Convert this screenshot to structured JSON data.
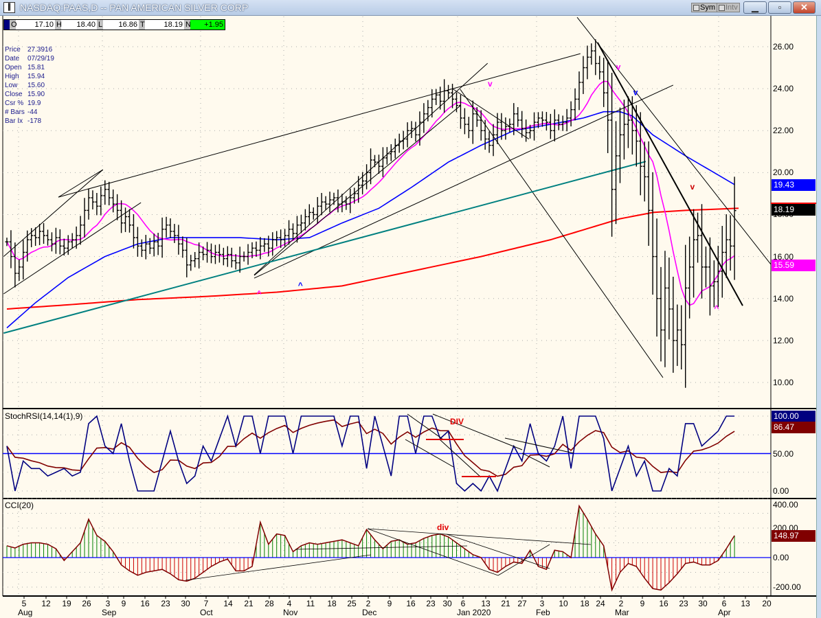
{
  "window": {
    "title": "NASDAQ:PAAS,D -- PAN AMERICAN SILVER CORP",
    "icon": "chart-app-icon",
    "sym_btn": "Sym",
    "intv_btn": "Intv",
    "minimize": "minimize-icon",
    "maximize": "maximize-icon",
    "close": "close-icon"
  },
  "ohlc_bar": {
    "o_label": "O",
    "o": "17.10",
    "h_label": "H",
    "h": "18.40",
    "l_label": "L",
    "l": "16.86",
    "t_label": "T",
    "t": "18.19",
    "n_label": "N",
    "n": "+1.95",
    "n_color": "#00ff00"
  },
  "info": [
    {
      "label": "Price",
      "value": "27.3916"
    },
    {
      "label": "Date",
      "value": "07/29/19"
    },
    {
      "label": "Open",
      "value": "15.81"
    },
    {
      "label": "High",
      "value": "15.94"
    },
    {
      "label": "Low",
      "value": "15.60"
    },
    {
      "label": "Close",
      "value": "15.90"
    },
    {
      "label": "Csr %",
      "value": "19.9"
    },
    {
      "label": "# Bars",
      "value": "-44"
    },
    {
      "label": "Bar Ix",
      "value": "-178"
    }
  ],
  "colors": {
    "ma_fast": "#ff00ff",
    "ma_mid": "#0000ff",
    "ma_slow": "#ff0000",
    "teal": "#008080",
    "up": "#008000",
    "down": "#cc0000",
    "cci_line": "#800000",
    "stoch_k": "#000080",
    "stoch_d": "#800000"
  },
  "chart_data": [
    {
      "type": "ohlc",
      "title": "NASDAQ:PAAS,D",
      "ylim": [
        9,
        27.5
      ],
      "yticks": [
        "26.00",
        "24.00",
        "22.00",
        "20.00",
        "18.00",
        "16.00",
        "14.00",
        "12.00",
        "10.00"
      ],
      "closes": [
        16.7,
        16.0,
        15.2,
        15.5,
        16.2,
        16.8,
        17.0,
        16.9,
        17.2,
        17.0,
        16.8,
        16.6,
        16.9,
        16.5,
        16.4,
        16.7,
        16.8,
        17.0,
        17.5,
        18.2,
        18.8,
        18.6,
        18.4,
        18.9,
        19.2,
        18.8,
        18.5,
        18.2,
        17.6,
        17.9,
        17.5,
        16.9,
        16.5,
        16.3,
        16.6,
        16.4,
        16.7,
        16.5,
        17.3,
        17.5,
        17.2,
        17.0,
        16.6,
        16.3,
        15.6,
        15.8,
        15.9,
        16.2,
        16.1,
        16.3,
        16.0,
        16.2,
        16.1,
        15.9,
        16.1,
        15.8,
        15.7,
        16.0,
        16.0,
        16.2,
        16.4,
        16.3,
        16.5,
        16.6,
        16.4,
        16.8,
        16.9,
        16.8,
        17.0,
        17.3,
        17.1,
        17.5,
        17.6,
        17.9,
        18.1,
        18.0,
        18.4,
        18.6,
        18.5,
        18.7,
        18.8,
        18.5,
        18.6,
        18.5,
        18.8,
        19.0,
        19.4,
        19.6,
        20.0,
        20.6,
        20.5,
        20.3,
        20.7,
        20.9,
        21.0,
        21.3,
        21.5,
        21.6,
        22.0,
        22.1,
        21.8,
        22.4,
        22.8,
        23.1,
        23.5,
        23.7,
        23.4,
        23.9,
        23.8,
        23.5,
        23.2,
        22.6,
        22.3,
        22.0,
        22.8,
        22.5,
        22.0,
        21.6,
        21.3,
        21.8,
        22.4,
        22.0,
        22.2,
        22.3,
        22.8,
        22.5,
        22.1,
        21.9,
        22.0,
        22.4,
        22.6,
        22.5,
        22.4,
        22.0,
        22.5,
        22.3,
        22.4,
        22.6,
        23.0,
        23.5,
        24.3,
        25.0,
        25.5,
        25.8,
        25.2,
        24.8,
        23.8,
        22.5,
        19.2,
        20.8,
        21.8,
        22.3,
        22.5,
        22.0,
        21.5,
        20.3,
        19.8,
        18.2,
        16.0,
        14.0,
        12.5,
        14.5,
        13.5,
        12.0,
        12.5,
        11.8,
        14.5,
        15.5,
        16.8,
        17.0,
        15.5,
        15.5,
        14.6,
        14.8,
        15.3,
        16.2,
        16.8,
        16.5,
        18.19
      ],
      "ma_mid": [
        [
          0,
          12.6
        ],
        [
          7,
          13.8
        ],
        [
          15,
          15.0
        ],
        [
          24,
          16.0
        ],
        [
          32,
          16.6
        ],
        [
          40,
          16.9
        ],
        [
          49,
          16.9
        ],
        [
          57,
          16.9
        ],
        [
          66,
          16.8
        ],
        [
          74,
          16.9
        ],
        [
          82,
          17.6
        ],
        [
          91,
          18.3
        ],
        [
          99,
          19.3
        ],
        [
          108,
          20.5
        ],
        [
          116,
          21.3
        ],
        [
          124,
          22.0
        ],
        [
          133,
          22.3
        ],
        [
          141,
          22.6
        ],
        [
          146,
          22.9
        ],
        [
          150,
          22.9
        ],
        [
          153,
          22.7
        ],
        [
          158,
          21.8
        ],
        [
          166,
          20.8
        ],
        [
          173,
          20.0
        ],
        [
          178,
          19.43
        ]
      ],
      "ma_slow": [
        [
          0,
          13.5
        ],
        [
          15,
          13.7
        ],
        [
          32,
          13.95
        ],
        [
          49,
          14.1
        ],
        [
          66,
          14.3
        ],
        [
          82,
          14.6
        ],
        [
          99,
          15.3
        ],
        [
          116,
          16.0
        ],
        [
          133,
          16.8
        ],
        [
          150,
          17.8
        ],
        [
          158,
          18.1
        ],
        [
          166,
          18.2
        ],
        [
          179,
          18.3
        ]
      ],
      "trendlines": [
        {
          "from": [
            12.6,
            18.83
          ],
          "to": [
            140.3,
            25.67
          ],
          "color": "#000"
        },
        {
          "from": [
            12.6,
            18.83
          ],
          "to": [
            23.5,
            20.14
          ],
          "color": "#000"
        },
        {
          "from": [
            -0.8,
            16.0
          ],
          "to": [
            23.5,
            20.14
          ],
          "color": "#000"
        },
        {
          "from": [
            -0.8,
            14.22
          ],
          "to": [
            32.8,
            18.57
          ],
          "color": "#000"
        },
        {
          "from": [
            60.5,
            15.13
          ],
          "to": [
            117.6,
            25.21
          ],
          "color": "#000"
        },
        {
          "from": [
            60.5,
            14.97
          ],
          "to": [
            163,
            24.17
          ],
          "color": "#000"
        },
        {
          "from": [
            60.5,
            15.1
          ],
          "to": [
            111,
            23.2
          ],
          "color": "#000"
        },
        {
          "from": [
            110.9,
            23.97
          ],
          "to": [
            160.5,
            10.23
          ],
          "color": "#000"
        },
        {
          "from": [
            109,
            24.0
          ],
          "to": [
            127.7,
            21.6
          ],
          "color": "#000"
        },
        {
          "from": [
            139.5,
            27.4
          ],
          "to": [
            187,
            15.6
          ],
          "color": "#000"
        },
        {
          "from": [
            -0.8,
            12.35
          ],
          "to": [
            156.3,
            20.53
          ],
          "color": "#008080",
          "width": 2
        },
        {
          "from": [
            144.5,
            26.2
          ],
          "to": [
            180,
            13.66
          ],
          "color": "#000",
          "width": 2
        }
      ],
      "annotations": [
        {
          "text": "^",
          "idx": 61.7,
          "price": 14.1,
          "color": "#ff00ff"
        },
        {
          "text": "^",
          "idx": 71.8,
          "price": 14.5,
          "color": "#0000ff"
        },
        {
          "text": "v",
          "idx": 118.2,
          "price": 24.1,
          "color": "#ff00ff"
        },
        {
          "text": "v",
          "idx": 149.6,
          "price": 24.9,
          "color": "#ff00ff"
        },
        {
          "text": "v",
          "idx": 153.8,
          "price": 23.7,
          "color": "#0000ff"
        },
        {
          "text": "v",
          "idx": 167.7,
          "price": 19.2,
          "color": "#cc0000"
        },
        {
          "text": "^",
          "idx": 173.6,
          "price": 13.4,
          "color": "#ff00ff"
        }
      ],
      "badges": [
        {
          "value": "19.43",
          "price": 19.43,
          "color": "#0000ff"
        },
        {
          "value": "18.19",
          "price": 18.19,
          "color": "#000000"
        },
        {
          "value": "15.59",
          "price": 15.59,
          "color": "#ff00ff"
        }
      ]
    },
    {
      "type": "line",
      "title": "StochRSI(14,14(1),9)",
      "ylim": [
        0,
        100
      ],
      "yticks": [
        "100.00",
        "50.00",
        "0.00"
      ],
      "step": 2,
      "k": [
        60,
        0,
        40,
        30,
        30,
        20,
        25,
        30,
        20,
        25,
        90,
        100,
        60,
        50,
        90,
        40,
        0,
        0,
        0,
        40,
        80,
        40,
        10,
        20,
        60,
        40,
        70,
        100,
        60,
        100,
        100,
        50,
        100,
        100,
        100,
        50,
        100,
        100,
        100,
        100,
        100,
        60,
        100,
        100,
        30,
        100,
        60,
        20,
        100,
        100,
        50,
        100,
        100,
        70,
        80,
        10,
        0,
        10,
        0,
        20,
        0,
        30,
        60,
        40,
        90,
        50,
        40,
        60,
        100,
        30,
        100,
        100,
        100,
        70,
        0,
        30,
        60,
        20,
        40,
        0,
        0,
        30,
        20,
        90,
        90,
        60,
        70,
        80,
        100,
        100
      ],
      "div_label": "DIV",
      "badges": [
        {
          "value": "100.00",
          "color": "#000080"
        },
        {
          "value": "86.47",
          "color": "#800000"
        }
      ]
    },
    {
      "type": "bar",
      "title": "CCI(20)",
      "ylim": [
        -260,
        400
      ],
      "yticks": [
        "400.00",
        "200.00",
        "0.00",
        "-200.00"
      ],
      "step": 2,
      "values": [
        80,
        65,
        90,
        100,
        100,
        90,
        60,
        -20,
        40,
        100,
        260,
        150,
        110,
        40,
        -50,
        -90,
        -120,
        -100,
        -90,
        -80,
        -110,
        -150,
        -160,
        -140,
        -100,
        -60,
        -30,
        -10,
        -90,
        -90,
        -60,
        240,
        90,
        160,
        150,
        40,
        80,
        100,
        90,
        100,
        110,
        120,
        100,
        80,
        190,
        120,
        60,
        110,
        120,
        90,
        100,
        130,
        150,
        160,
        140,
        100,
        60,
        20,
        0,
        -80,
        -100,
        -60,
        -30,
        -40,
        50,
        -60,
        -80,
        50,
        40,
        0,
        350,
        260,
        160,
        80,
        -220,
        -100,
        -40,
        -60,
        -140,
        -210,
        -220,
        -170,
        -110,
        -40,
        -30,
        -50,
        -50,
        -20,
        60,
        149
      ],
      "div_label": "div",
      "badge": {
        "value": "148.97",
        "color": "#800000"
      }
    },
    {
      "type": "axis",
      "days": [
        "5",
        "12",
        "19",
        "26",
        "3",
        "9",
        "16",
        "23",
        "30",
        "7",
        "14",
        "21",
        "28",
        "4",
        "11",
        "18",
        "25",
        "2",
        "9",
        "16",
        "23",
        "30",
        "6",
        "13",
        "21",
        "27",
        "3",
        "10",
        "18",
        "24",
        "2",
        "9",
        "16",
        "23",
        "30",
        "6",
        "13",
        "20"
      ],
      "months": [
        "Aug",
        "Sep",
        "Oct",
        "Nov",
        "Dec",
        "Jan 2020",
        "Feb",
        "Mar",
        "Apr"
      ]
    }
  ]
}
